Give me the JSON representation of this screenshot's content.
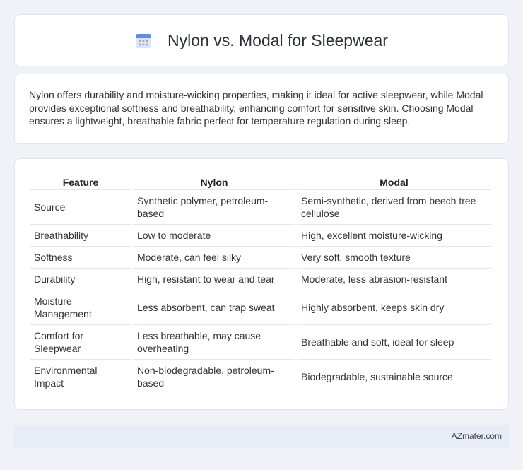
{
  "header": {
    "title": "Nylon vs. Modal for Sleepwear",
    "icon": "calendar-icon"
  },
  "summary": {
    "text": "Nylon offers durability and moisture-wicking properties, making it ideal for active sleepwear, while Modal provides exceptional softness and breathability, enhancing comfort for sensitive skin. Choosing Modal ensures a lightweight, breathable fabric perfect for temperature regulation during sleep."
  },
  "table": {
    "headers": [
      "Feature",
      "Nylon",
      "Modal"
    ],
    "rows": [
      [
        "Source",
        "Synthetic polymer, petroleum-based",
        "Semi-synthetic, derived from beech tree cellulose"
      ],
      [
        "Breathability",
        "Low to moderate",
        "High, excellent moisture-wicking"
      ],
      [
        "Softness",
        "Moderate, can feel silky",
        "Very soft, smooth texture"
      ],
      [
        "Durability",
        "High, resistant to wear and tear",
        "Moderate, less abrasion-resistant"
      ],
      [
        "Moisture Management",
        "Less absorbent, can trap sweat",
        "Highly absorbent, keeps skin dry"
      ],
      [
        "Comfort for Sleepwear",
        "Less breathable, may cause overheating",
        "Breathable and soft, ideal for sleep"
      ],
      [
        "Environmental Impact",
        "Non-biodegradable, petroleum-based",
        "Biodegradable, sustainable source"
      ]
    ]
  },
  "footer": {
    "brand": "AZmater.com"
  }
}
